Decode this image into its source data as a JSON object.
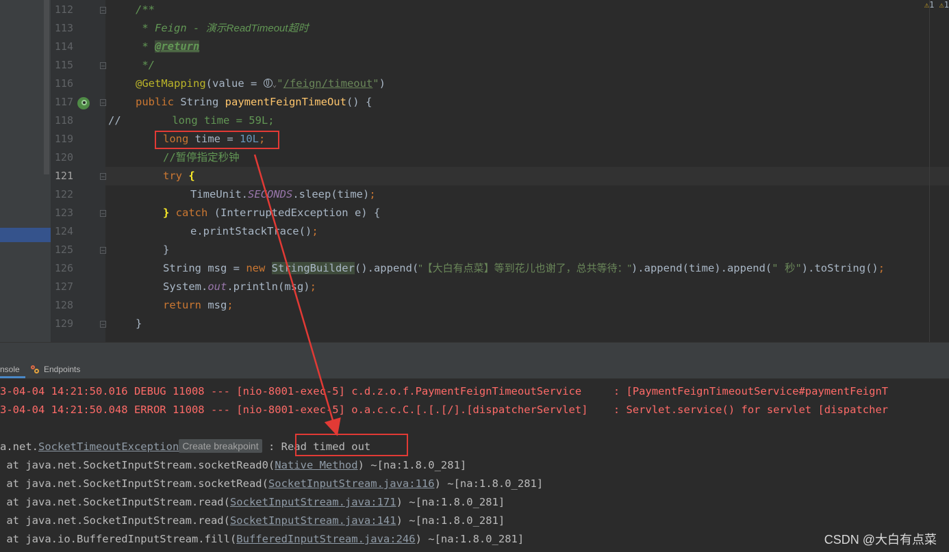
{
  "editor": {
    "warnings": {
      "a": "1",
      "b": "1"
    },
    "lines": [
      {
        "n": "112"
      },
      {
        "n": "113"
      },
      {
        "n": "114"
      },
      {
        "n": "115"
      },
      {
        "n": "116"
      },
      {
        "n": "117"
      },
      {
        "n": "118"
      },
      {
        "n": "119"
      },
      {
        "n": "120"
      },
      {
        "n": "121"
      },
      {
        "n": "122"
      },
      {
        "n": "123"
      },
      {
        "n": "124"
      },
      {
        "n": "125"
      },
      {
        "n": "126"
      },
      {
        "n": "127"
      },
      {
        "n": "128"
      },
      {
        "n": "129"
      }
    ],
    "code": {
      "l112": "/**",
      "l113_a": " * Feign - ",
      "l113_b": "演示ReadTimeout超时",
      "l114_a": " * ",
      "l114_tag": "@return",
      "l115": " */",
      "l116_ann": "@GetMapping",
      "l116_a": "(value = ",
      "l116_str_a": "\"",
      "l116_path": "/feign/timeout",
      "l116_str_b": "\"",
      "l116_b": ")",
      "l117_kw": "public ",
      "l117_type": "String ",
      "l117_fn": "paymentFeignTimeOut",
      "l117_rest": "() {",
      "l118_cm": "//",
      "l118_rest": "        long time = 59L;",
      "l119_kw": "long ",
      "l119_var": "time = ",
      "l119_num": "10L",
      "l119_semi": ";",
      "l120": "//暂停指定秒钟",
      "l121_kw": "try ",
      "l121_brace": "{",
      "l122_a": "TimeUnit.",
      "l122_static": "SECONDS",
      "l122_b": ".sleep(time)",
      "l122_semi": ";",
      "l123_brace": "}",
      "l123_kw": " catch ",
      "l123_rest": "(InterruptedException e) {",
      "l124_a": "e.printStackTrace()",
      "l124_semi": ";",
      "l125": "}",
      "l126_a": "String msg = ",
      "l126_kw": "new ",
      "l126_cls": "StringBuilder",
      "l126_b": "().append(",
      "l126_str1": "\"【大白有点菜】等到花儿也谢了，总共等待：\"",
      "l126_c": ").append(time).append(",
      "l126_str2": "\" 秒\"",
      "l126_d": ").toString()",
      "l126_semi": ";",
      "l127_a": "System.",
      "l127_static": "out",
      "l127_b": ".println(msg)",
      "l127_semi": ";",
      "l128_kw": "return ",
      "l128_rest": "msg",
      "l128_semi": ";",
      "l129": "}"
    }
  },
  "tabs": {
    "console": "nsole",
    "endpoints": "Endpoints"
  },
  "console": {
    "debug_line": "3-04-04 14:21:50.016 DEBUG 11008 --- [nio-8001-exec-5] c.d.z.o.f.PaymentFeignTimeoutService     : [PaymentFeignTimeoutService#paymentFeignT",
    "error_line": "3-04-04 14:21:50.048 ERROR 11008 --- [nio-8001-exec-5] o.a.c.c.C.[.[.[/].[dispatcherServlet]    : Servlet.service() for servlet [dispatcher",
    "exc_prefix": "a.net.",
    "exc_class": "SocketTimeoutException",
    "exc_hint": "Create breakpoint",
    "exc_sep": " : ",
    "exc_msg": "Read timed out",
    "stack": [
      {
        "pre": " at java.net.SocketInputStream.socketRead0(",
        "link": "Native Method",
        "post": ") ~[na:1.8.0_281]"
      },
      {
        "pre": " at java.net.SocketInputStream.socketRead(",
        "link": "SocketInputStream.java:116",
        "post": ") ~[na:1.8.0_281]"
      },
      {
        "pre": " at java.net.SocketInputStream.read(",
        "link": "SocketInputStream.java:171",
        "post": ") ~[na:1.8.0_281]"
      },
      {
        "pre": " at java.net.SocketInputStream.read(",
        "link": "SocketInputStream.java:141",
        "post": ") ~[na:1.8.0_281]"
      },
      {
        "pre": " at java.io.BufferedInputStream.fill(",
        "link": "BufferedInputStream.java:246",
        "post": ") ~[na:1.8.0_281]"
      }
    ]
  },
  "watermark": "CSDN @大白有点菜",
  "colors": {
    "annotation_box": "#e23a35",
    "keyword": "#cc7832",
    "string": "#6a8759",
    "error_text": "#ff6b68"
  }
}
